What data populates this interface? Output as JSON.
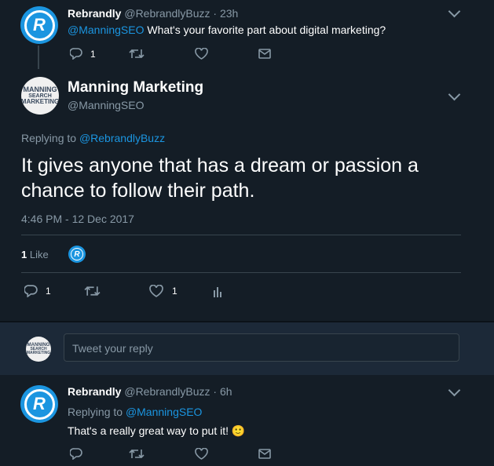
{
  "tweet1": {
    "name": "Rebrandly",
    "handle": "@RebrandlyBuzz",
    "time": "· 23h",
    "mention": "@ManningSEO",
    "text": " What's your favorite part about digital marketing?",
    "reply_count": "1"
  },
  "main": {
    "name": "Manning Marketing",
    "handle": "@ManningSEO",
    "replying_prefix": "Replying to ",
    "replying_handle": "@RebrandlyBuzz",
    "text": "It gives anyone that has a dream or passion a chance to follow their path.",
    "timestamp": "4:46 PM - 12 Dec 2017",
    "likes_num": "1",
    "likes_label": "Like",
    "reply_count": "1",
    "like_count": "1"
  },
  "reply_box": {
    "placeholder": "Tweet your reply"
  },
  "tweet3": {
    "name": "Rebrandly",
    "handle": "@RebrandlyBuzz",
    "time": "· 6h",
    "replying_prefix": "Replying to ",
    "replying_handle": "@ManningSEO",
    "text": "That's a really great way to put it! 🙂"
  },
  "avatar_text": {
    "rebrandly": "R",
    "manning_line1": "MANNING",
    "manning_line2": "SEARCH",
    "manning_line3": "MARKETING"
  },
  "icons": {
    "reply": "reply-icon",
    "retweet": "retweet-icon",
    "like": "heart-icon",
    "dm": "envelope-icon",
    "analytics": "analytics-icon",
    "caret": "chevron-down-icon"
  },
  "colors": {
    "background": "#141d26",
    "link": "#1b95e0",
    "muted": "#8899a6",
    "rebrandly_brand": "#1b95e0"
  }
}
